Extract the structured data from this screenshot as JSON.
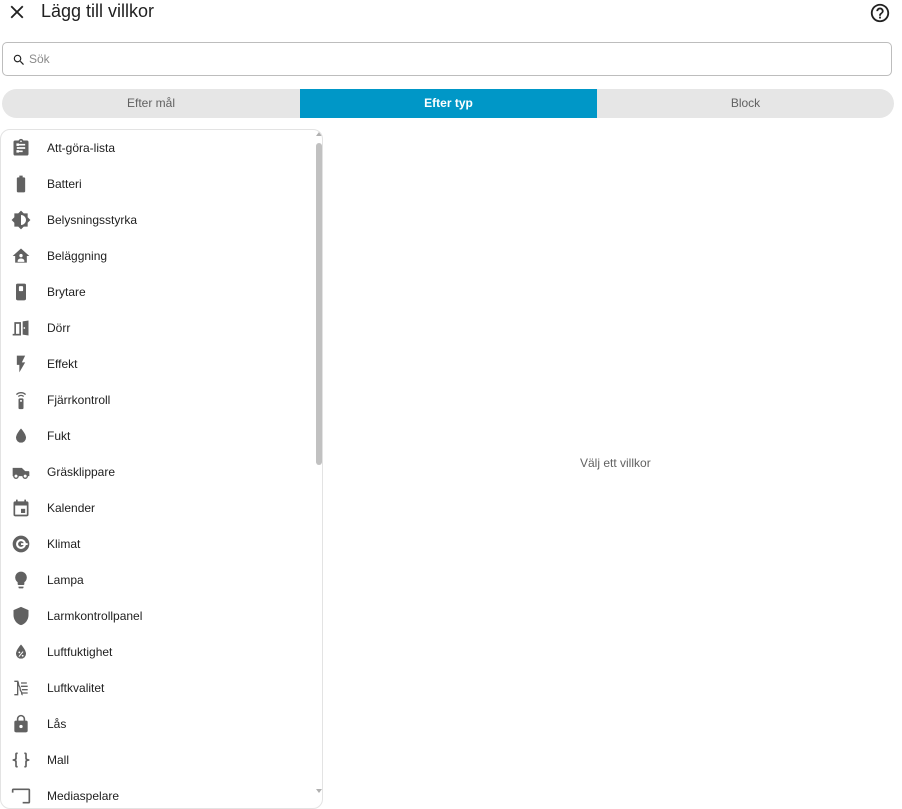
{
  "dialog": {
    "title": "Lägg till villkor",
    "close_icon": "close-icon",
    "help_icon": "help-circle-icon"
  },
  "search": {
    "placeholder": "Sök",
    "value": "",
    "icon": "magnify-icon"
  },
  "tabs": [
    {
      "label": "Efter mål",
      "active": false
    },
    {
      "label": "Efter typ",
      "active": true
    },
    {
      "label": "Block",
      "active": false
    }
  ],
  "list": {
    "items": [
      {
        "label": "Att-göra-lista",
        "icon": "clipboard-list-icon"
      },
      {
        "label": "Batteri",
        "icon": "battery-icon"
      },
      {
        "label": "Belysningsstyrka",
        "icon": "brightness-icon"
      },
      {
        "label": "Beläggning",
        "icon": "home-account-icon"
      },
      {
        "label": "Brytare",
        "icon": "switch-icon"
      },
      {
        "label": "Dörr",
        "icon": "door-open-icon"
      },
      {
        "label": "Effekt",
        "icon": "flash-icon"
      },
      {
        "label": "Fjärrkontroll",
        "icon": "remote-icon"
      },
      {
        "label": "Fukt",
        "icon": "water-drop-icon"
      },
      {
        "label": "Gräsklippare",
        "icon": "robot-mower-icon"
      },
      {
        "label": "Kalender",
        "icon": "calendar-icon"
      },
      {
        "label": "Klimat",
        "icon": "thermostat-icon"
      },
      {
        "label": "Lampa",
        "icon": "lightbulb-icon"
      },
      {
        "label": "Larmkontrollpanel",
        "icon": "shield-icon"
      },
      {
        "label": "Luftfuktighet",
        "icon": "water-percent-icon"
      },
      {
        "label": "Luftkvalitet",
        "icon": "air-filter-icon"
      },
      {
        "label": "Lås",
        "icon": "lock-icon"
      },
      {
        "label": "Mall",
        "icon": "code-braces-icon"
      },
      {
        "label": "Mediaspelare",
        "icon": "cast-icon"
      }
    ]
  },
  "detail": {
    "empty_text": "Välj ett villkor"
  },
  "colors": {
    "accent": "#0097c7",
    "icon": "#616161",
    "tab_bg": "#e6e6e6"
  }
}
